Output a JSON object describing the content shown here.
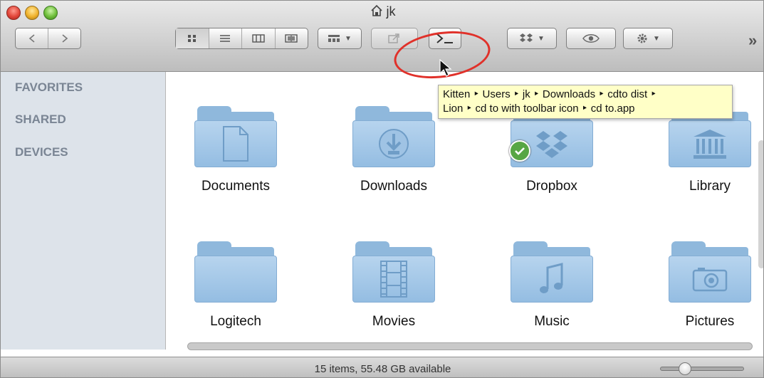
{
  "window": {
    "title": "jk"
  },
  "toolbar": {
    "overflow_label": "»"
  },
  "sidebar": {
    "sections": [
      "FAVORITES",
      "SHARED",
      "DEVICES"
    ]
  },
  "tooltip": {
    "line1": "Kitten ‣ Users ‣ jk ‣ Downloads ‣ cdto dist ‣",
    "line2": "Lion ‣ cd to with toolbar icon ‣ cd to.app"
  },
  "items": [
    {
      "label": "Documents",
      "icon": "document-folder-icon"
    },
    {
      "label": "Downloads",
      "icon": "downloads-folder-icon"
    },
    {
      "label": "Dropbox",
      "icon": "dropbox-folder-icon"
    },
    {
      "label": "Library",
      "icon": "library-folder-icon"
    },
    {
      "label": "Logitech",
      "icon": "folder-icon"
    },
    {
      "label": "Movies",
      "icon": "movies-folder-icon"
    },
    {
      "label": "Music",
      "icon": "music-folder-icon"
    },
    {
      "label": "Pictures",
      "icon": "pictures-folder-icon"
    }
  ],
  "status": {
    "text": "15 items, 55.48 GB available",
    "icon_size_fraction": 0.2
  },
  "colors": {
    "annotation": "#e0312a",
    "tooltip_bg": "#ffffc7",
    "sidebar_bg": "#dde3ea"
  }
}
